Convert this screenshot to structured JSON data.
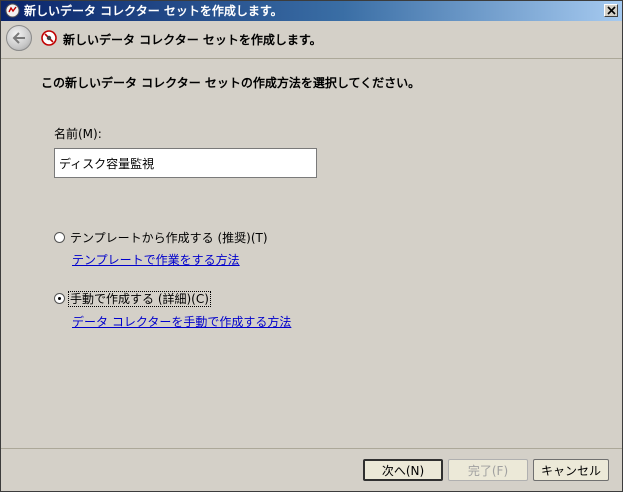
{
  "window": {
    "title": "新しいデータ コレクター セットを作成します。"
  },
  "header": {
    "title": "新しいデータ コレクター セットを作成します。"
  },
  "content": {
    "prompt": "この新しいデータ コレクター セットの作成方法を選択してください。",
    "name_label": "名前(M):",
    "name_value": "ディスク容量監視",
    "options": [
      {
        "label": "テンプレートから作成する (推奨)(T)",
        "link": "テンプレートで作業をする方法",
        "selected": false
      },
      {
        "label": "手動で作成する (詳細)(C)",
        "link": "データ コレクターを手動で作成する方法",
        "selected": true
      }
    ]
  },
  "footer": {
    "next_label": "次へ(N)",
    "finish_label": "完了(F)",
    "cancel_label": "キャンセル"
  },
  "icons": {
    "app": "perfmon-icon",
    "wizard": "no-entry-icon",
    "back": "back-arrow-icon",
    "close": "close-icon"
  }
}
